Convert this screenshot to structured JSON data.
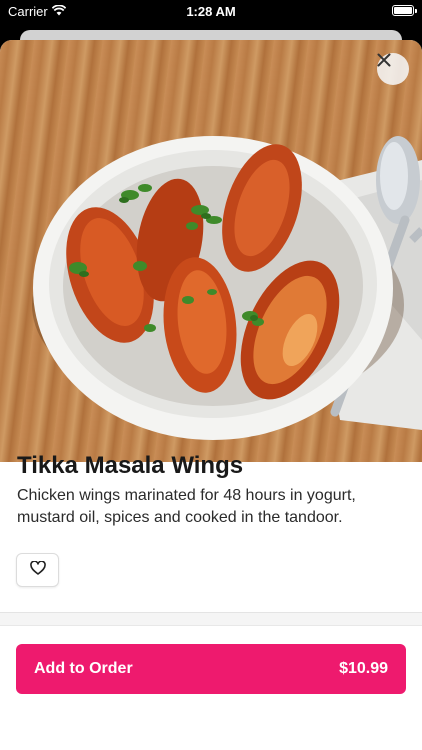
{
  "status_bar": {
    "carrier": "Carrier",
    "time": "1:28 AM"
  },
  "item": {
    "name": "Tikka Masala Wings",
    "description": "Chicken wings marinated for 48 hours in yogurt, mustard oil, spices and cooked in the tandoor.",
    "price": "$10.99"
  },
  "actions": {
    "add_to_order": "Add to Order"
  },
  "icons": {
    "close": "close-icon",
    "favorite": "heart-outline-icon",
    "wifi": "wifi-icon",
    "battery": "battery-icon"
  },
  "colors": {
    "accent": "#ee1a6e"
  }
}
